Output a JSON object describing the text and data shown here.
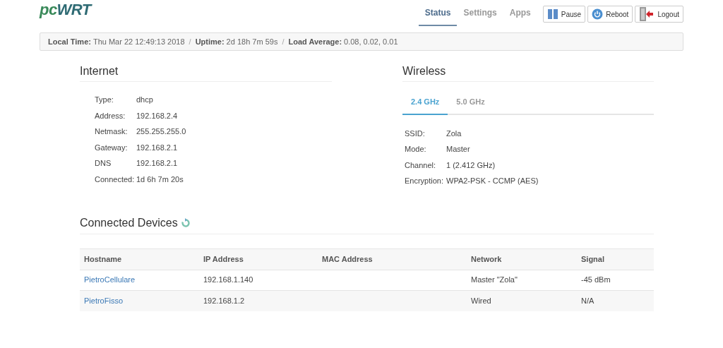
{
  "logo": {
    "prefix": "pc",
    "suffix": "WRT"
  },
  "nav": [
    {
      "label": "Status",
      "selected": true
    },
    {
      "label": "Settings",
      "selected": false
    },
    {
      "label": "Apps",
      "selected": false
    }
  ],
  "buttons": [
    {
      "label": "Pause",
      "kind": "pause"
    },
    {
      "label": "Reboot",
      "kind": "reboot"
    },
    {
      "label": "Logout",
      "kind": "logout"
    }
  ],
  "status_bar": [
    {
      "kind": "field",
      "label": "Local Time:",
      "value": "Thu Mar 22 12:49:13 2018"
    },
    {
      "kind": "separator",
      "text": "/"
    },
    {
      "kind": "field",
      "label": "Uptime:",
      "value": "2d 18h 7m 59s"
    },
    {
      "kind": "separator",
      "text": "/"
    },
    {
      "kind": "field",
      "label": "Load Average:",
      "value": "0.08, 0.02, 0.01"
    }
  ],
  "internet": {
    "title": "Internet",
    "fields": [
      {
        "label": "Type:",
        "value": "dhcp"
      },
      {
        "label": "Address:",
        "value": "192.168.2.4"
      },
      {
        "label": "Netmask:",
        "value": "255.255.255.0"
      },
      {
        "label": "Gateway:",
        "value": "192.168.2.1"
      },
      {
        "label": "DNS",
        "value": "192.168.2.1"
      },
      {
        "label": "Connected:",
        "value": "1d 6h 7m 20s"
      }
    ]
  },
  "wireless": {
    "title": "Wireless",
    "tabs": [
      {
        "label": "2.4 GHz",
        "selected": true
      },
      {
        "label": "5.0 GHz",
        "selected": false
      }
    ],
    "fields": [
      {
        "label": "SSID:",
        "value": "Zola"
      },
      {
        "label": "Mode:",
        "value": "Master"
      },
      {
        "label": "Channel:",
        "value": "1 (2.412 GHz)"
      },
      {
        "label": "Encryption:",
        "value": "WPA2-PSK - CCMP (AES)"
      }
    ]
  },
  "devices": {
    "title": "Connected Devices",
    "columns": [
      "Hostname",
      "IP Address",
      "MAC Address",
      "Network",
      "Signal"
    ],
    "rows": [
      {
        "hostname": "PietroCellulare",
        "ip": "192.168.1.140",
        "network": "Master \"Zola\"",
        "signal": "-45 dBm"
      },
      {
        "hostname": "PietroFisso",
        "ip": "192.168.1.2",
        "network": "Wired",
        "signal": "N/A"
      }
    ]
  }
}
